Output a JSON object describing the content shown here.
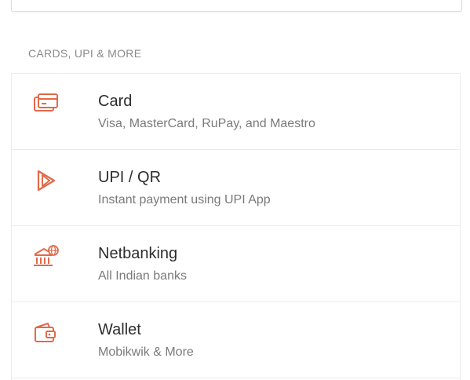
{
  "section_title": "CARDS, UPI & MORE",
  "accent_color": "#e06a4a",
  "methods": [
    {
      "icon": "card-icon",
      "label": "Card",
      "description": "Visa, MasterCard, RuPay, and Maestro"
    },
    {
      "icon": "upi-icon",
      "label": "UPI / QR",
      "description": "Instant payment using UPI App"
    },
    {
      "icon": "bank-icon",
      "label": "Netbanking",
      "description": "All Indian banks"
    },
    {
      "icon": "wallet-icon",
      "label": "Wallet",
      "description": "Mobikwik & More"
    }
  ]
}
